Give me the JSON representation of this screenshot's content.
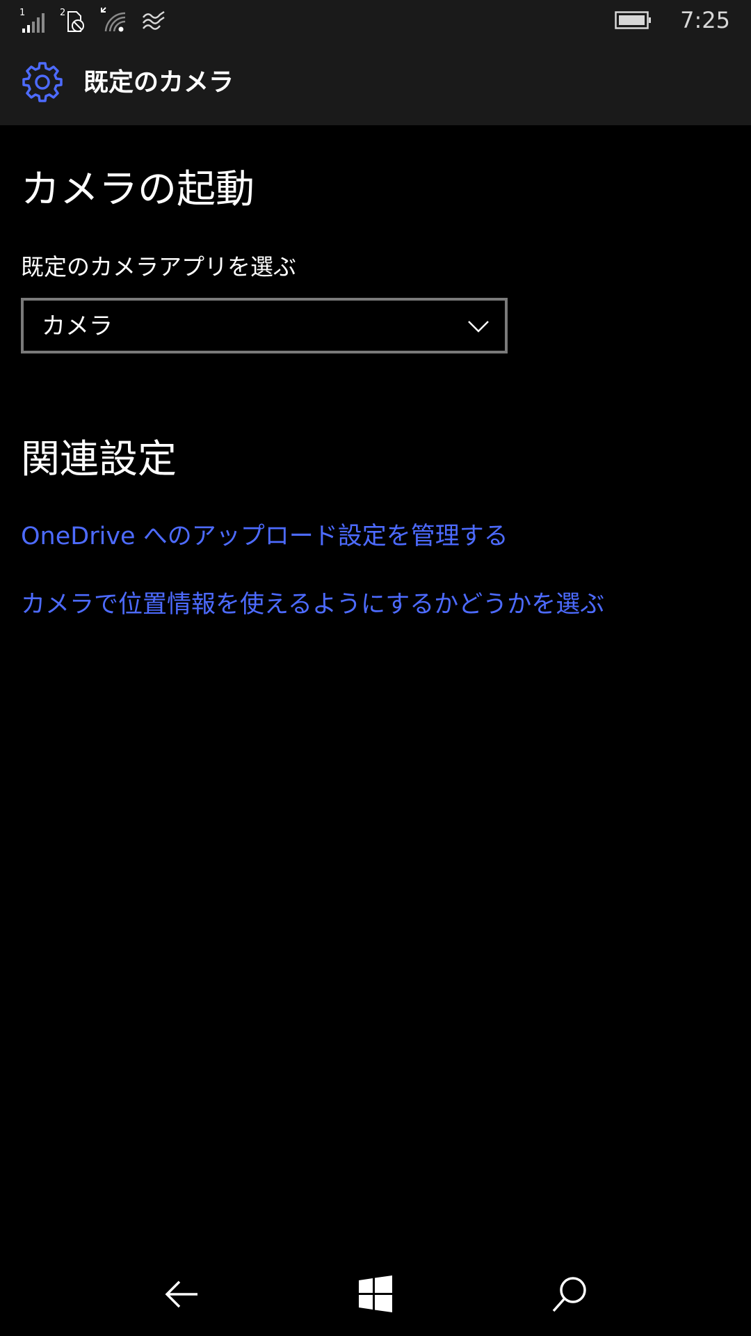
{
  "status_bar": {
    "sim1_label": "1",
    "sim2_label": "2",
    "time": "7:25",
    "icons": [
      "signal-strength-icon",
      "sim-no-service-icon",
      "wifi-icon",
      "data-sense-icon",
      "battery-icon"
    ]
  },
  "header": {
    "title": "既定のカメラ",
    "icon": "gear-icon"
  },
  "main": {
    "camera_launch": {
      "heading": "カメラの起動",
      "label": "既定のカメラアプリを選ぶ",
      "dropdown_value": "カメラ"
    },
    "related": {
      "heading": "関連設定",
      "links": [
        "OneDrive へのアップロード設定を管理する",
        "カメラで位置情報を使えるようにするかどうかを選ぶ"
      ]
    }
  },
  "nav_bar": {
    "icons": [
      "back-arrow-icon",
      "windows-start-icon",
      "search-icon"
    ]
  },
  "colors": {
    "background": "#000000",
    "bar_background": "#1a1a1a",
    "accent": "#4d6bff"
  }
}
